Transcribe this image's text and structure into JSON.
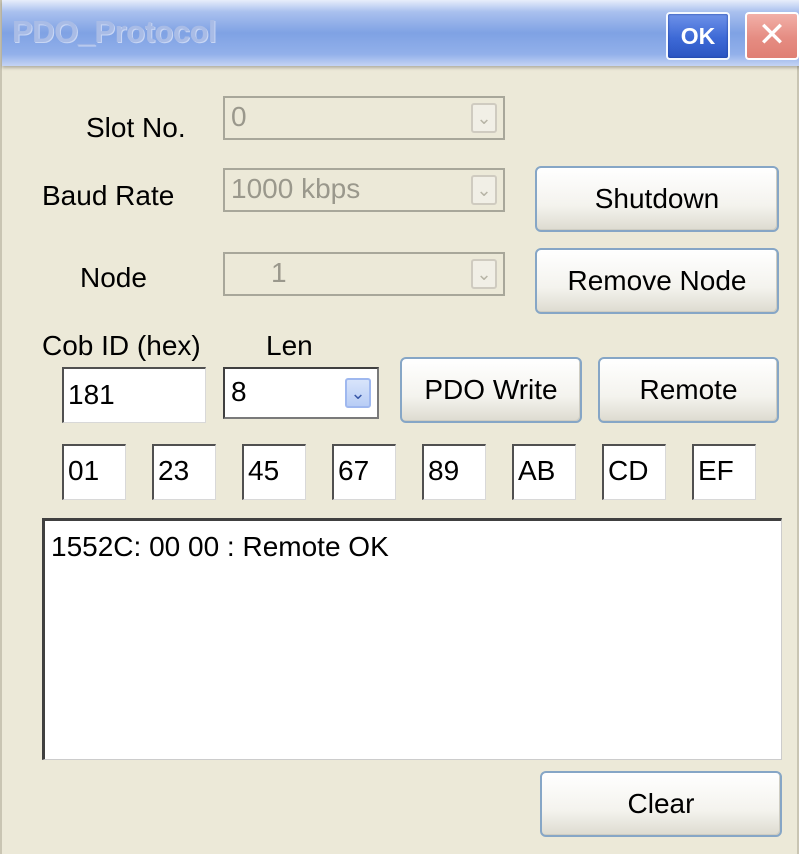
{
  "window": {
    "title": "PDO_Protocol",
    "ok_label": "OK",
    "close_glyph": "✕"
  },
  "form": {
    "slot_no": {
      "label": "Slot No.",
      "value": "0",
      "enabled": false
    },
    "baud_rate": {
      "label": "Baud Rate",
      "value": "1000 kbps",
      "enabled": false
    },
    "node": {
      "label": "Node",
      "value": "1",
      "enabled": false
    },
    "cob_id": {
      "label": "Cob ID (hex)",
      "value": "181"
    },
    "len": {
      "label": "Len",
      "value": "8"
    },
    "data_bytes": [
      "01",
      "23",
      "45",
      "67",
      "89",
      "AB",
      "CD",
      "EF"
    ]
  },
  "buttons": {
    "shutdown": "Shutdown",
    "remove_node": "Remove Node",
    "pdo_write": "PDO Write",
    "remote": "Remote",
    "clear": "Clear"
  },
  "output": {
    "lines": [
      "1552C: 00 00 : Remote OK"
    ]
  },
  "icons": {
    "dropdown_arrow": "chevron-down-icon",
    "close": "close-icon"
  }
}
